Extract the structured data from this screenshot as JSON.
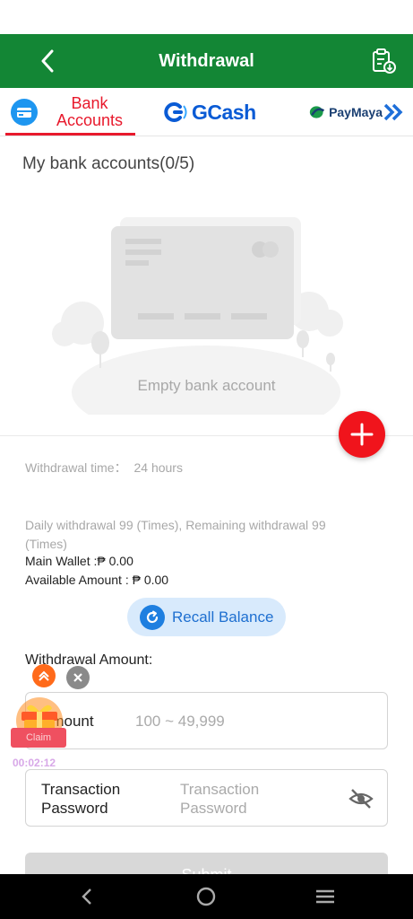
{
  "header": {
    "title": "Withdrawal"
  },
  "tabs": {
    "bank_label": "Bank Accounts",
    "gcash_label": "GCash",
    "paymaya_label": "PayMaya"
  },
  "bank_section": {
    "title": "My bank accounts(0/5)",
    "empty_text": "Empty bank account"
  },
  "info": {
    "withdrawal_time_label": "Withdrawal time：",
    "withdrawal_time_value": "24 hours",
    "daily_limit": "Daily withdrawal 99 (Times), Remaining withdrawal 99 (Times)",
    "main_wallet": "Main Wallet :₱ 0.00",
    "available_amount": "Available Amount : ₱ 0.00"
  },
  "recall": {
    "label": "Recall Balance"
  },
  "form": {
    "amount_title": "Withdrawal Amount:",
    "amount_label": "Amount",
    "amount_placeholder": "100 ~ 49,999",
    "password_label": "Transaction Password",
    "password_placeholder": "Transaction Password",
    "submit_label": "Submit"
  },
  "promo": {
    "claim_label": "Claim",
    "timer": "00:02:12"
  },
  "colors": {
    "header_bg": "#138635",
    "accent_red": "#e8192c",
    "recall_bg": "#d8eafc",
    "gcash_blue": "#0a5bd5"
  },
  "icons": {
    "back": "chevron-left-icon",
    "record": "clipboard-download-icon",
    "bank": "bank-card-icon",
    "gcash": "gcash-logo-icon",
    "paymaya": "paymaya-logo-icon",
    "more": "double-chevron-right-icon",
    "add": "plus-icon",
    "recall": "refresh-icon",
    "eye": "eye-off-icon"
  }
}
